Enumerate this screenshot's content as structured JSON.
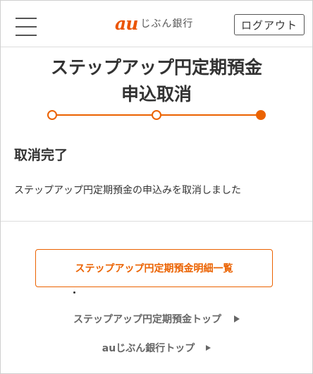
{
  "header": {
    "logo_mark": "au",
    "logo_text": "じぶん銀行",
    "logout_label": "ログアウト"
  },
  "page": {
    "title_line1": "ステップアップ円定期預金",
    "title_line2": "申込取消",
    "progress": {
      "total_steps": 3,
      "current_step": 3
    }
  },
  "content": {
    "heading": "取消完了",
    "message": "ステップアップ円定期預金の申込みを取消しました"
  },
  "links": {
    "primary": "ステップアップ円定期預金明細一覧",
    "top_link": "ステップアップ円定期預金トップ",
    "bank_top_link": "auじぶん銀行トップ"
  },
  "colors": {
    "accent": "#eb6200",
    "text": "#333333",
    "link_gray": "#666666"
  },
  "icons": {
    "menu": "hamburger-menu-icon",
    "arrow": "triangle-right-icon"
  }
}
